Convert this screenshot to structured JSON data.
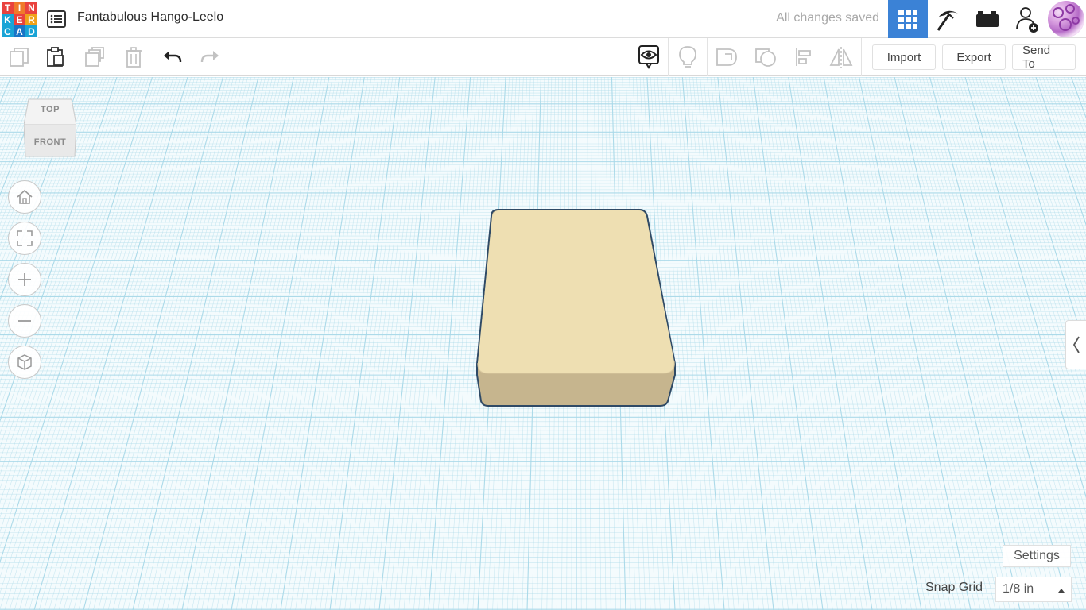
{
  "app": {
    "logo_letters": [
      "T",
      "I",
      "N",
      "K",
      "E",
      "R",
      "C",
      "A",
      "D"
    ],
    "design_title": "Fantabulous Hango-Leelo",
    "save_status": "All changes saved"
  },
  "header": {
    "modes": [
      {
        "icon": "grid-icon",
        "active": true
      },
      {
        "icon": "pickaxe-icon",
        "active": false
      },
      {
        "icon": "brick-icon",
        "active": false
      },
      {
        "icon": "add-user-icon",
        "active": false
      }
    ],
    "avatar_icon": "avatar"
  },
  "toolbar": {
    "left_tools": [
      "copy-icon",
      "paste-icon",
      "duplicate-icon",
      "delete-icon",
      "undo-icon",
      "redo-icon"
    ],
    "view_tools": [
      "show-all-icon",
      "light-bulb-icon",
      "group-icon",
      "ungroup-icon",
      "align-icon",
      "mirror-icon"
    ],
    "import_label": "Import",
    "export_label": "Export",
    "send_to_label": "Send To"
  },
  "viewcube": {
    "top_label": "TOP",
    "front_label": "FRONT"
  },
  "nav_controls": [
    "home-icon",
    "fit-view-icon",
    "zoom-in-icon",
    "zoom-out-icon",
    "perspective-icon"
  ],
  "footer": {
    "settings_label": "Settings",
    "snap_grid_label": "Snap Grid",
    "snap_grid_value": "1/8 in"
  },
  "colors": {
    "accent": "#3b82d6",
    "grid_line": "#a8d8e8",
    "shape_top": "#eedfb2",
    "shape_side": "#c6b58e",
    "shape_edge": "#2f4a66"
  }
}
